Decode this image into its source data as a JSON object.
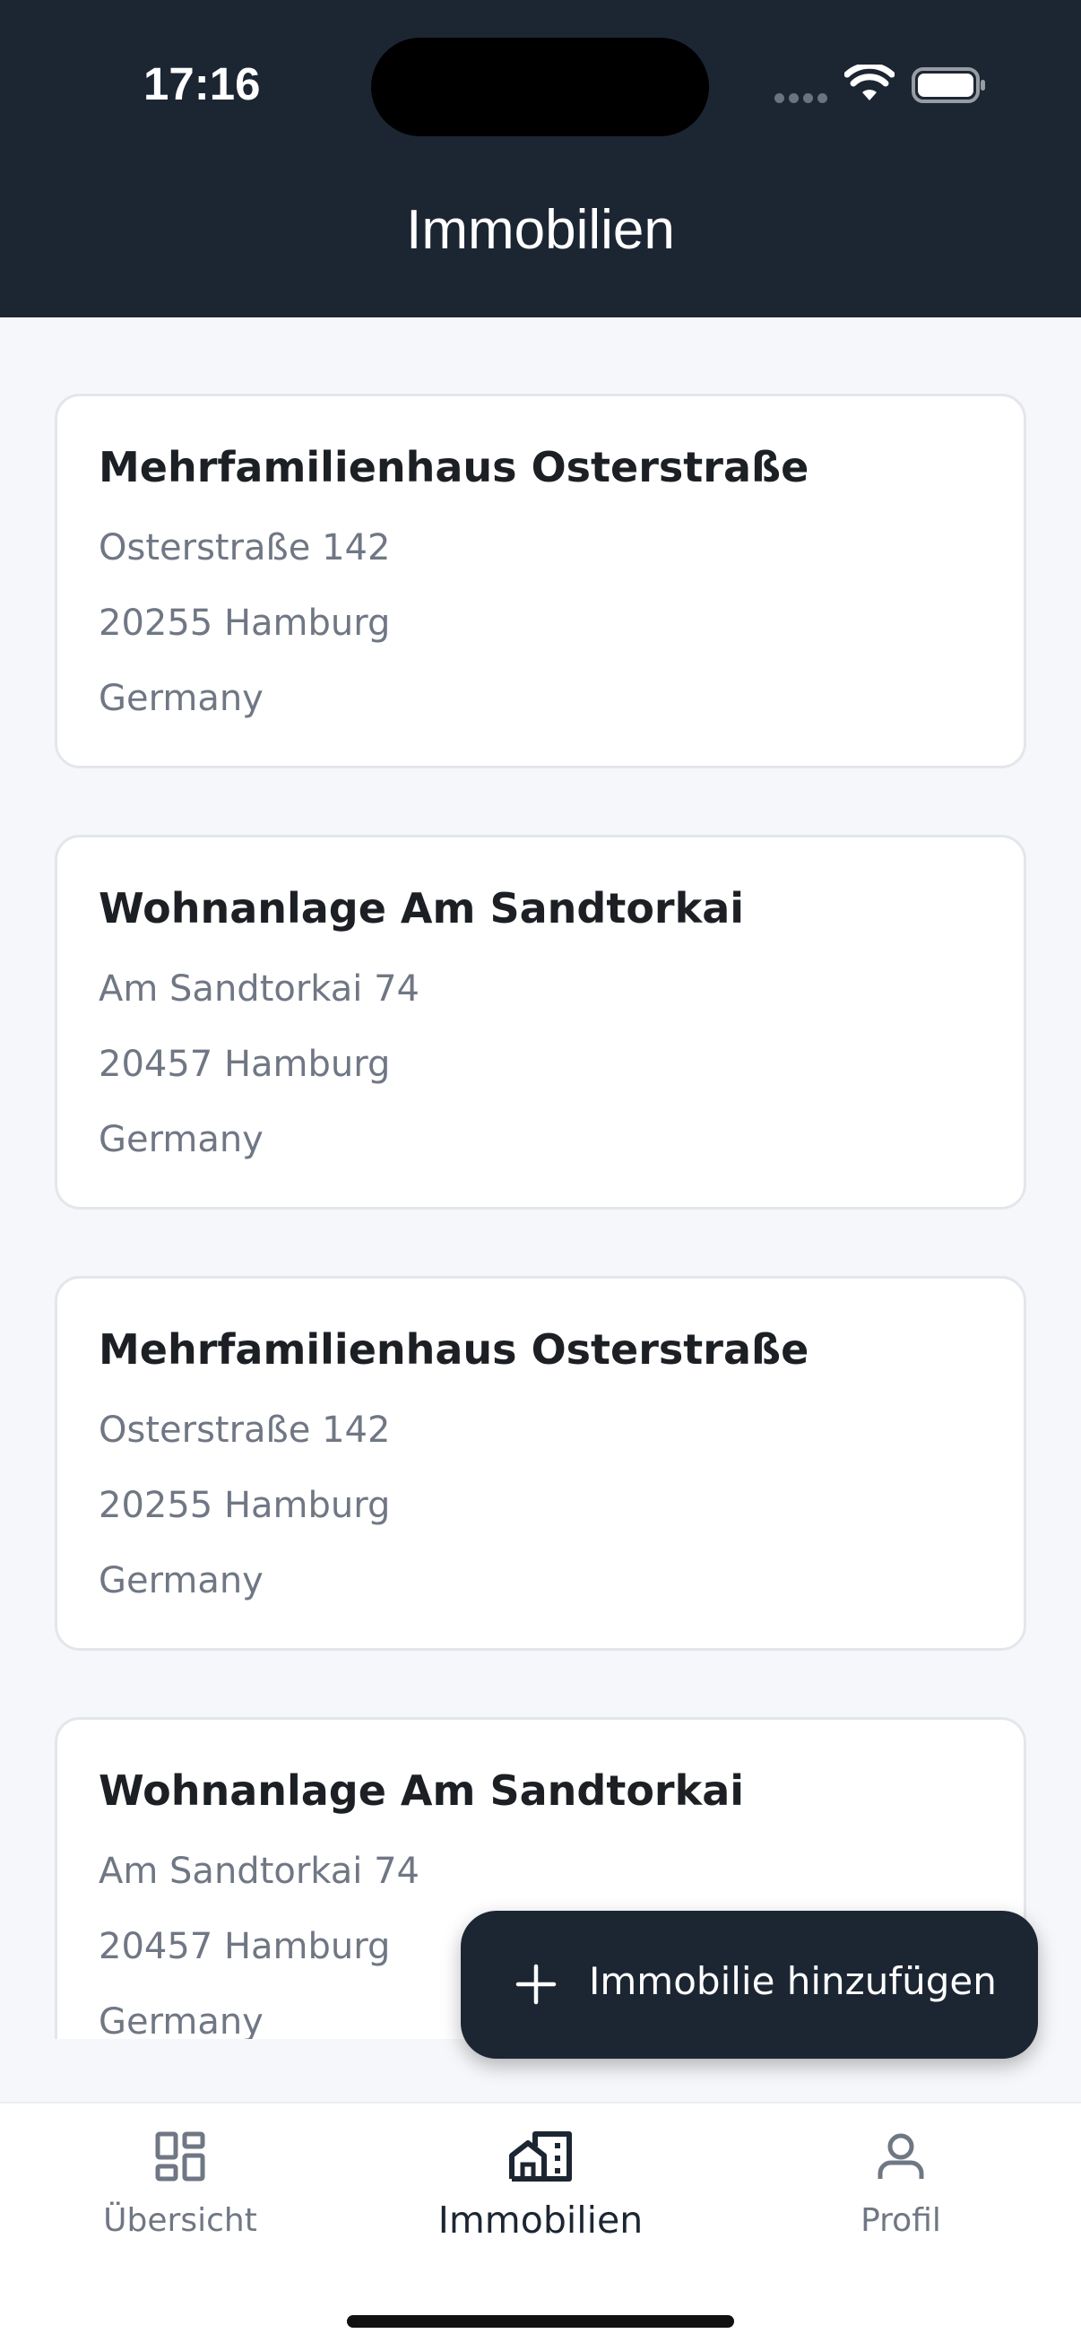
{
  "status_bar": {
    "time": "17:16"
  },
  "header": {
    "title": "Immobilien"
  },
  "properties": [
    {
      "name": "Mehrfamilienhaus Osterstraße",
      "street": "Osterstraße 142",
      "city": "20255 Hamburg",
      "country": "Germany"
    },
    {
      "name": "Wohnanlage Am Sandtorkai",
      "street": "Am Sandtorkai 74",
      "city": "20457 Hamburg",
      "country": "Germany"
    },
    {
      "name": "Mehrfamilienhaus Osterstraße",
      "street": "Osterstraße 142",
      "city": "20255 Hamburg",
      "country": "Germany"
    },
    {
      "name": "Wohnanlage Am Sandtorkai",
      "street": "Am Sandtorkai 74",
      "city": "20457 Hamburg",
      "country": "Germany"
    }
  ],
  "fab": {
    "icon": "plus-icon",
    "label": "Immobilie hinzufügen"
  },
  "bottom_nav": {
    "items": [
      {
        "label": "Übersicht",
        "icon": "dashboard-icon",
        "active": false
      },
      {
        "label": "Immobilien",
        "icon": "building-icon",
        "active": true
      },
      {
        "label": "Profil",
        "icon": "user-icon",
        "active": false
      }
    ]
  },
  "colors": {
    "header_bg": "#1c2633",
    "page_bg": "#f6f7fa",
    "card_border": "#e3e6eb",
    "text_primary": "#1c1f24",
    "text_secondary": "#707784"
  }
}
